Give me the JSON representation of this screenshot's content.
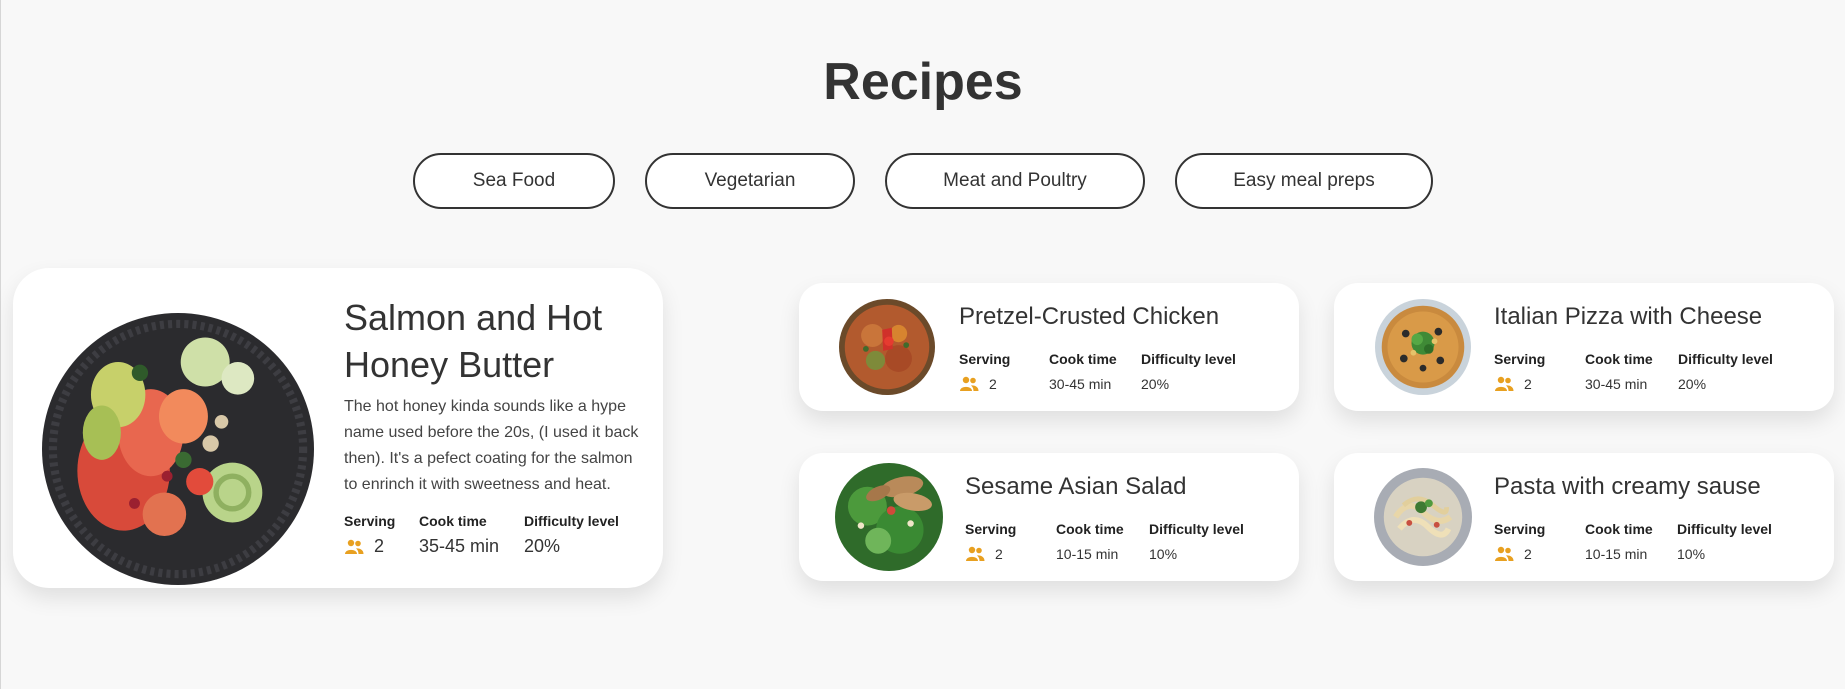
{
  "page": {
    "title": "Recipes"
  },
  "filters": [
    "Sea Food",
    "Vegetarian",
    "Meat and Poultry",
    "Easy meal preps"
  ],
  "stat_labels": {
    "serving": "Serving",
    "cook_time": "Cook time",
    "difficulty": "Difficulty level"
  },
  "featured": {
    "name": "Salmon and Hot Honey Butter",
    "description": "The hot honey kinda sounds like a hype name used before the 20s, (I used it back then). It's a pefect coating for the salmon to enrinch it with sweetness and heat.",
    "serving": "2",
    "cook_time": "35-45 min",
    "difficulty": "20%"
  },
  "recipes": [
    {
      "name": "Pretzel-Crusted Chicken",
      "serving": "2",
      "cook_time": "30-45 min",
      "difficulty": "20%"
    },
    {
      "name": "Italian Pizza with Cheese",
      "serving": "2",
      "cook_time": "30-45 min",
      "difficulty": "20%"
    },
    {
      "name": "Sesame Asian Salad",
      "serving": "2",
      "cook_time": "10-15 min",
      "difficulty": "10%"
    },
    {
      "name": "Pasta with creamy sause",
      "serving": "2",
      "cook_time": "10-15 min",
      "difficulty": "10%"
    }
  ],
  "colors": {
    "accent_icon": "#e8a020",
    "text": "#333333",
    "card": "#ffffff",
    "background": "#f8f8f8"
  },
  "icons": {
    "serving": "people-icon"
  }
}
